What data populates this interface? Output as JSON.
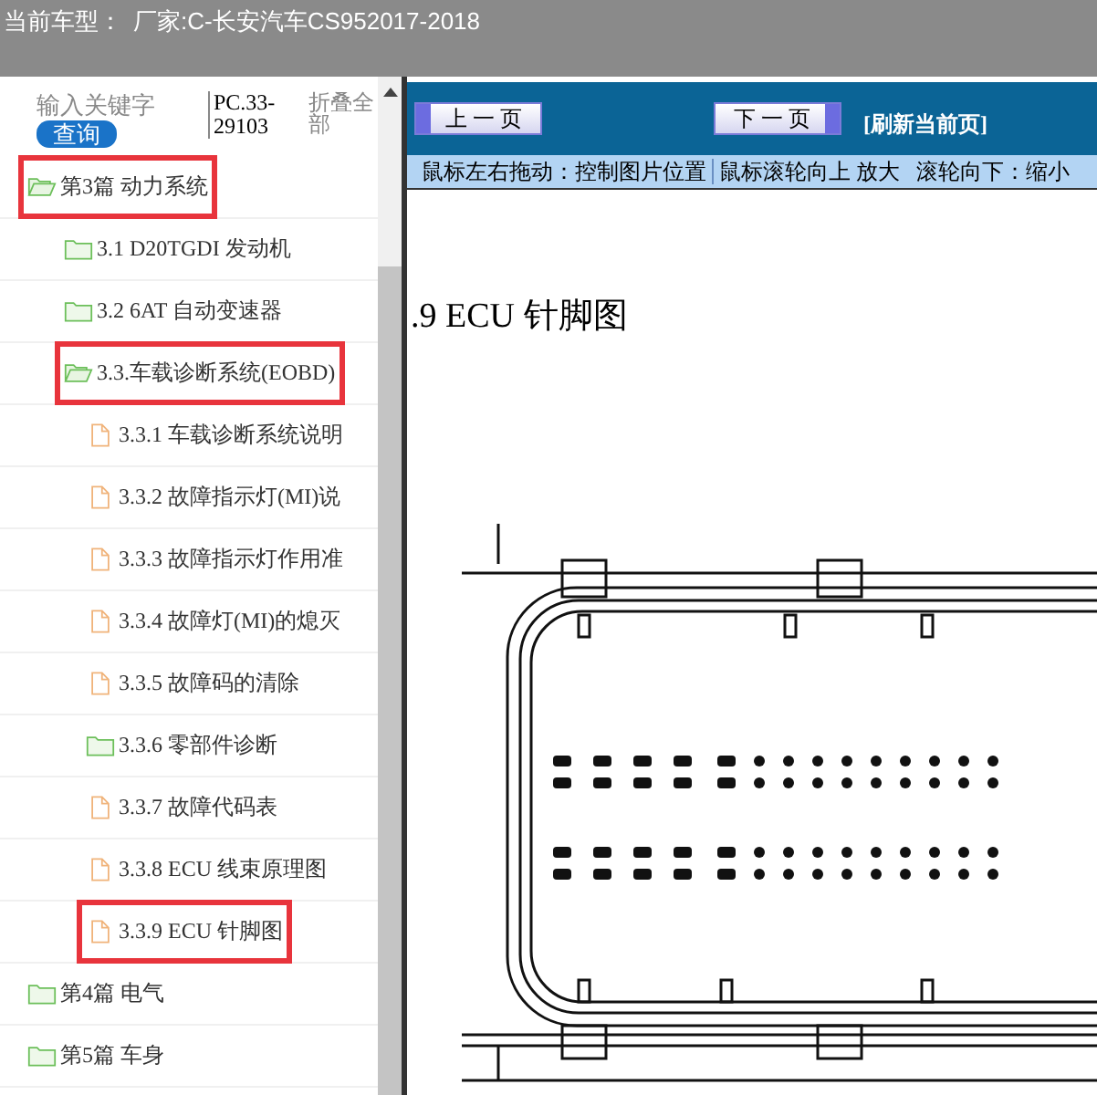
{
  "title_bar": {
    "label": "当前车型：",
    "value": "厂家:C-长安汽车CS952017-2018"
  },
  "sidebar": {
    "search": {
      "placeholder": "输入关键字"
    },
    "search_button": "查询",
    "code": "PC.33-29103",
    "collapse_link": "折叠全部",
    "tree": [
      {
        "label": "第3篇 动力系统",
        "kind": "folder",
        "expanded": true,
        "highlighted": true,
        "children": [
          {
            "label": "3.1 D20TGDI 发动机",
            "kind": "folder",
            "expanded": false,
            "highlighted": false
          },
          {
            "label": "3.2 6AT 自动变速器",
            "kind": "folder",
            "expanded": false,
            "highlighted": false
          },
          {
            "label": "3.3.车载诊断系统(EOBD)",
            "kind": "folder",
            "expanded": true,
            "highlighted": true,
            "children": [
              {
                "label": "3.3.1 车载诊断系统说明",
                "kind": "file",
                "highlighted": false
              },
              {
                "label": "3.3.2 故障指示灯(MI)说",
                "kind": "file",
                "highlighted": false
              },
              {
                "label": "3.3.3 故障指示灯作用准",
                "kind": "file",
                "highlighted": false
              },
              {
                "label": "3.3.4 故障灯(MI)的熄灭",
                "kind": "file",
                "highlighted": false
              },
              {
                "label": "3.3.5 故障码的清除",
                "kind": "file",
                "highlighted": false
              },
              {
                "label": "3.3.6 零部件诊断",
                "kind": "folder",
                "expanded": false,
                "highlighted": false
              },
              {
                "label": "3.3.7 故障代码表",
                "kind": "file",
                "highlighted": false
              },
              {
                "label": "3.3.8 ECU 线束原理图",
                "kind": "file",
                "highlighted": false
              },
              {
                "label": "3.3.9 ECU 针脚图",
                "kind": "file",
                "highlighted": true
              }
            ]
          }
        ]
      },
      {
        "label": "第4篇 电气",
        "kind": "folder",
        "expanded": false,
        "highlighted": false
      },
      {
        "label": "第5篇 车身",
        "kind": "folder",
        "expanded": false,
        "highlighted": false
      }
    ]
  },
  "toolbar": {
    "prev_button": "上 一 页",
    "next_button": "下 一 页",
    "refresh_link": "[刷新当前页]"
  },
  "hint_bar": [
    "鼠标左右拖动：控制图片位置",
    "鼠标滚轮向上 放大",
    "滚轮向下：缩小"
  ],
  "document": {
    "heading": ".9 ECU 针脚图"
  }
}
